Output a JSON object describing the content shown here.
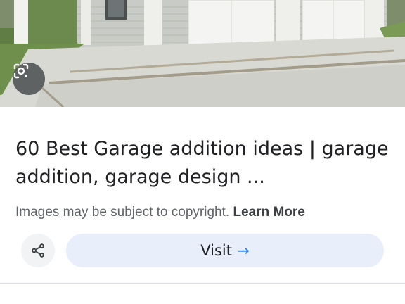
{
  "result": {
    "title": "60 Best Garage addition ideas | garage addition, garage design ...",
    "copyright_text": "Images may be subject to copyright.",
    "learn_more_label": "Learn More",
    "visit_label": "Visit",
    "visit_arrow": "→"
  },
  "icons": {
    "lens": "google-lens-icon",
    "share": "share-icon"
  },
  "colors": {
    "visit_button_bg": "#e8effb",
    "arrow_accent": "#1a73e8",
    "title_text": "#202124",
    "muted_text": "#5f6368"
  }
}
